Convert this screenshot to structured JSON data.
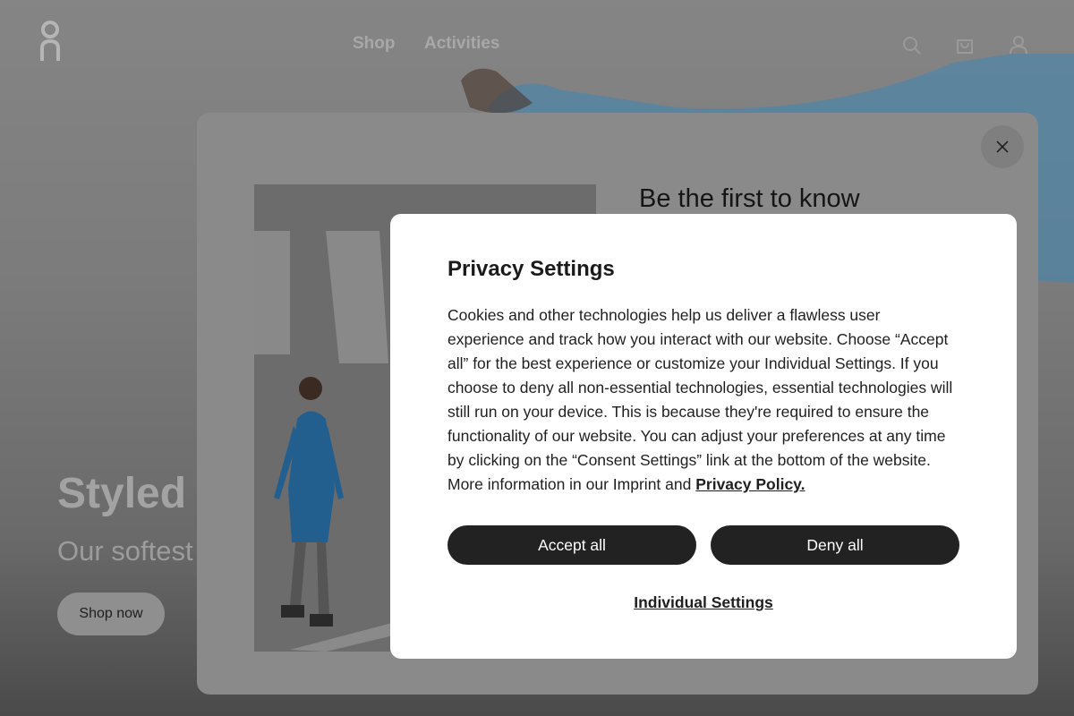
{
  "nav": {
    "links": [
      "Shop",
      "Activities"
    ],
    "icons": [
      "search-icon",
      "bag-icon",
      "account-icon"
    ]
  },
  "hero": {
    "title": "Styled y",
    "subtitle": "Our softest",
    "cta": "Shop now"
  },
  "newsletter": {
    "title": "Be the first to know"
  },
  "privacy": {
    "title": "Privacy Settings",
    "body": "Cookies and other technologies help us deliver a flawless user experience and track how you interact with our website. Choose “Accept all” for the best experience or customize your Individual Settings. If you choose to deny all non-essential technologies, essential technologies will still run on your device. This is because they're required to ensure the functionality of our website. You can adjust your preferences at any time by clicking on the “Consent Settings” link at the bottom of the website. More information in our Imprint and ",
    "policy_link": "Privacy Policy.",
    "accept_label": "Accept all",
    "deny_label": "Deny all",
    "individual_label": "Individual Settings"
  },
  "colors": {
    "overlay": "#7b7b7b",
    "dialog_bg": "#ffffff",
    "button_bg": "#222222",
    "button_text": "#ffffff",
    "sweater": "#3f86b4"
  }
}
